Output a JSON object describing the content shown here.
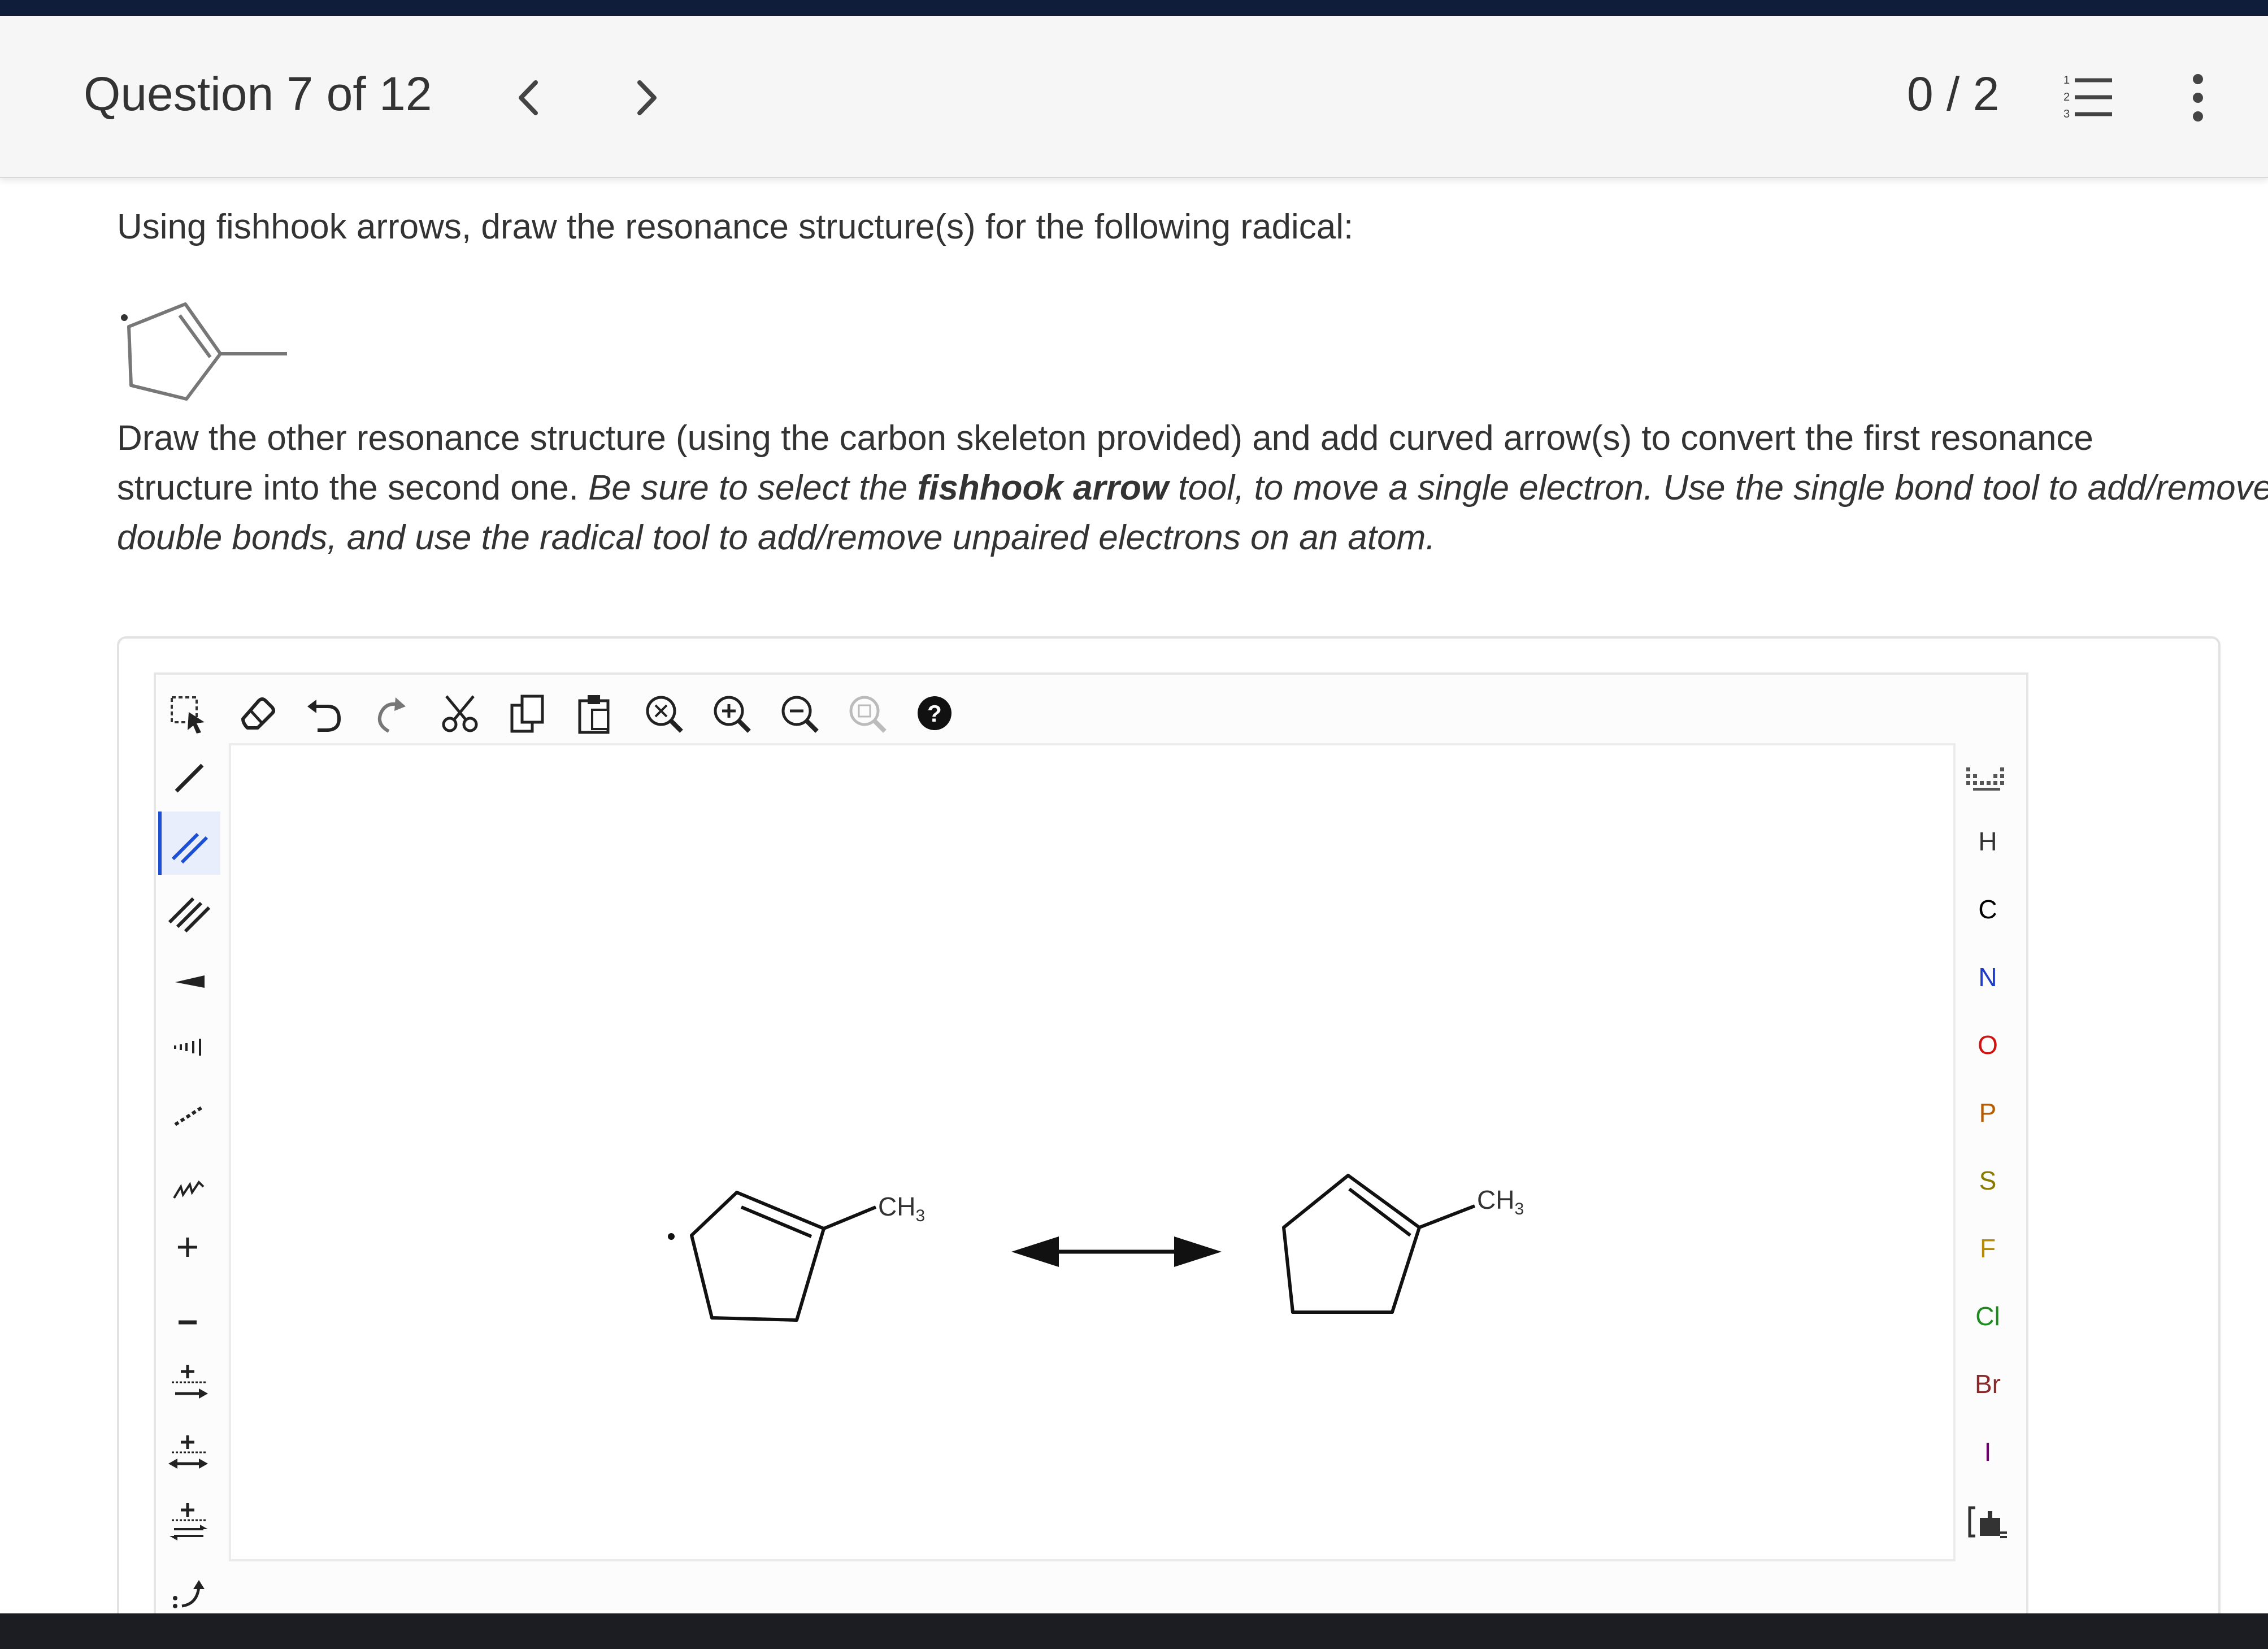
{
  "header": {
    "question_label": "Question 7 of 12",
    "prev_icon": "chevron-left-icon",
    "next_icon": "chevron-right-icon",
    "score": "0 / 2",
    "list_icon": "numbered-list-icon",
    "more_icon": "more-vertical-icon"
  },
  "question": {
    "prompt": "Using fishhook arrows, draw the resonance structure(s) for the following radical:",
    "instructions": {
      "line1": "Draw the other resonance structure (using the carbon skeleton provided) and add curved arrow(s) to convert the first resonance",
      "line2_plain": "structure into the second one.",
      "line2_italic": "Be sure to select the",
      "line2_bold": "fishhook arrow",
      "line2_tail": "tool, to move a single electron. Use the single bond tool to add/remove",
      "line3": "double bonds, and use the radical tool to add/remove unpaired electrons on an atom."
    }
  },
  "toolbar": {
    "icons": [
      "select-icon",
      "eraser-icon",
      "undo-icon",
      "redo-icon",
      "cut-icon",
      "copy-icon",
      "paste-icon",
      "zoom-fit-icon",
      "zoom-in-icon",
      "zoom-out-icon",
      "zoom-reset-icon",
      "help-icon"
    ],
    "help_glyph": "?"
  },
  "left_tools": [
    "single-bond-icon",
    "double-bond-icon",
    "triple-bond-icon",
    "wedge-bond-icon",
    "hash-bond-icon",
    "dashed-bond-icon",
    "wavy-bond-icon",
    "plus-charge-icon",
    "minus-charge-icon",
    "reaction-arrow-icon",
    "resonance-arrow-icon",
    "equilibrium-arrow-icon",
    "curved-arrow-icon"
  ],
  "left_glyphs": {
    "plus": "+",
    "minus": "−"
  },
  "atoms": [
    {
      "symbol": "H",
      "color": "#333333"
    },
    {
      "symbol": "C",
      "color": "#000000"
    },
    {
      "symbol": "N",
      "color": "#1f3cc7"
    },
    {
      "symbol": "O",
      "color": "#d11010"
    },
    {
      "symbol": "P",
      "color": "#b85c00"
    },
    {
      "symbol": "S",
      "color": "#8a7a00"
    },
    {
      "symbol": "F",
      "color": "#b88a00"
    },
    {
      "symbol": "Cl",
      "color": "#1f8a1f"
    },
    {
      "symbol": "Br",
      "color": "#8a2a2a"
    },
    {
      "symbol": "I",
      "color": "#6a006a"
    }
  ],
  "canvas": {
    "left_label": "CH",
    "left_sub": "3",
    "right_label": "CH",
    "right_sub": "3"
  },
  "colors": {
    "accent": "#1a4fd6",
    "header_bg": "#f6f6f6",
    "top_bar": "#0f1c3a"
  }
}
